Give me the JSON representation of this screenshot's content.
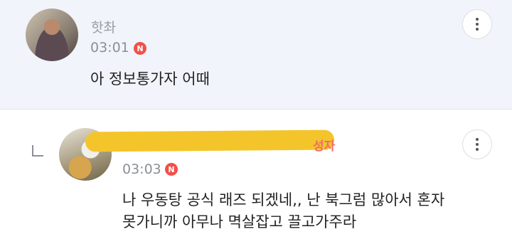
{
  "comments": [
    {
      "author": "핫촤",
      "time": "03:01",
      "new_badge": "N",
      "text": "아 정보통가자 어때"
    },
    {
      "author_tag": "성자",
      "time": "03:03",
      "new_badge": "N",
      "text": "나 우동탕 공식 래즈 되겠네,, 난 북그럼 많아서 혼자\n못가니까 아무나 멱살잡고 끌고가주라"
    }
  ],
  "colors": {
    "highlight_bg": "#f1f4fa",
    "new_badge": "#f0514a",
    "redaction": "#f4c52b"
  },
  "icons": {
    "more": "vertical-ellipsis-icon",
    "reply": "reply-arrow-icon"
  }
}
